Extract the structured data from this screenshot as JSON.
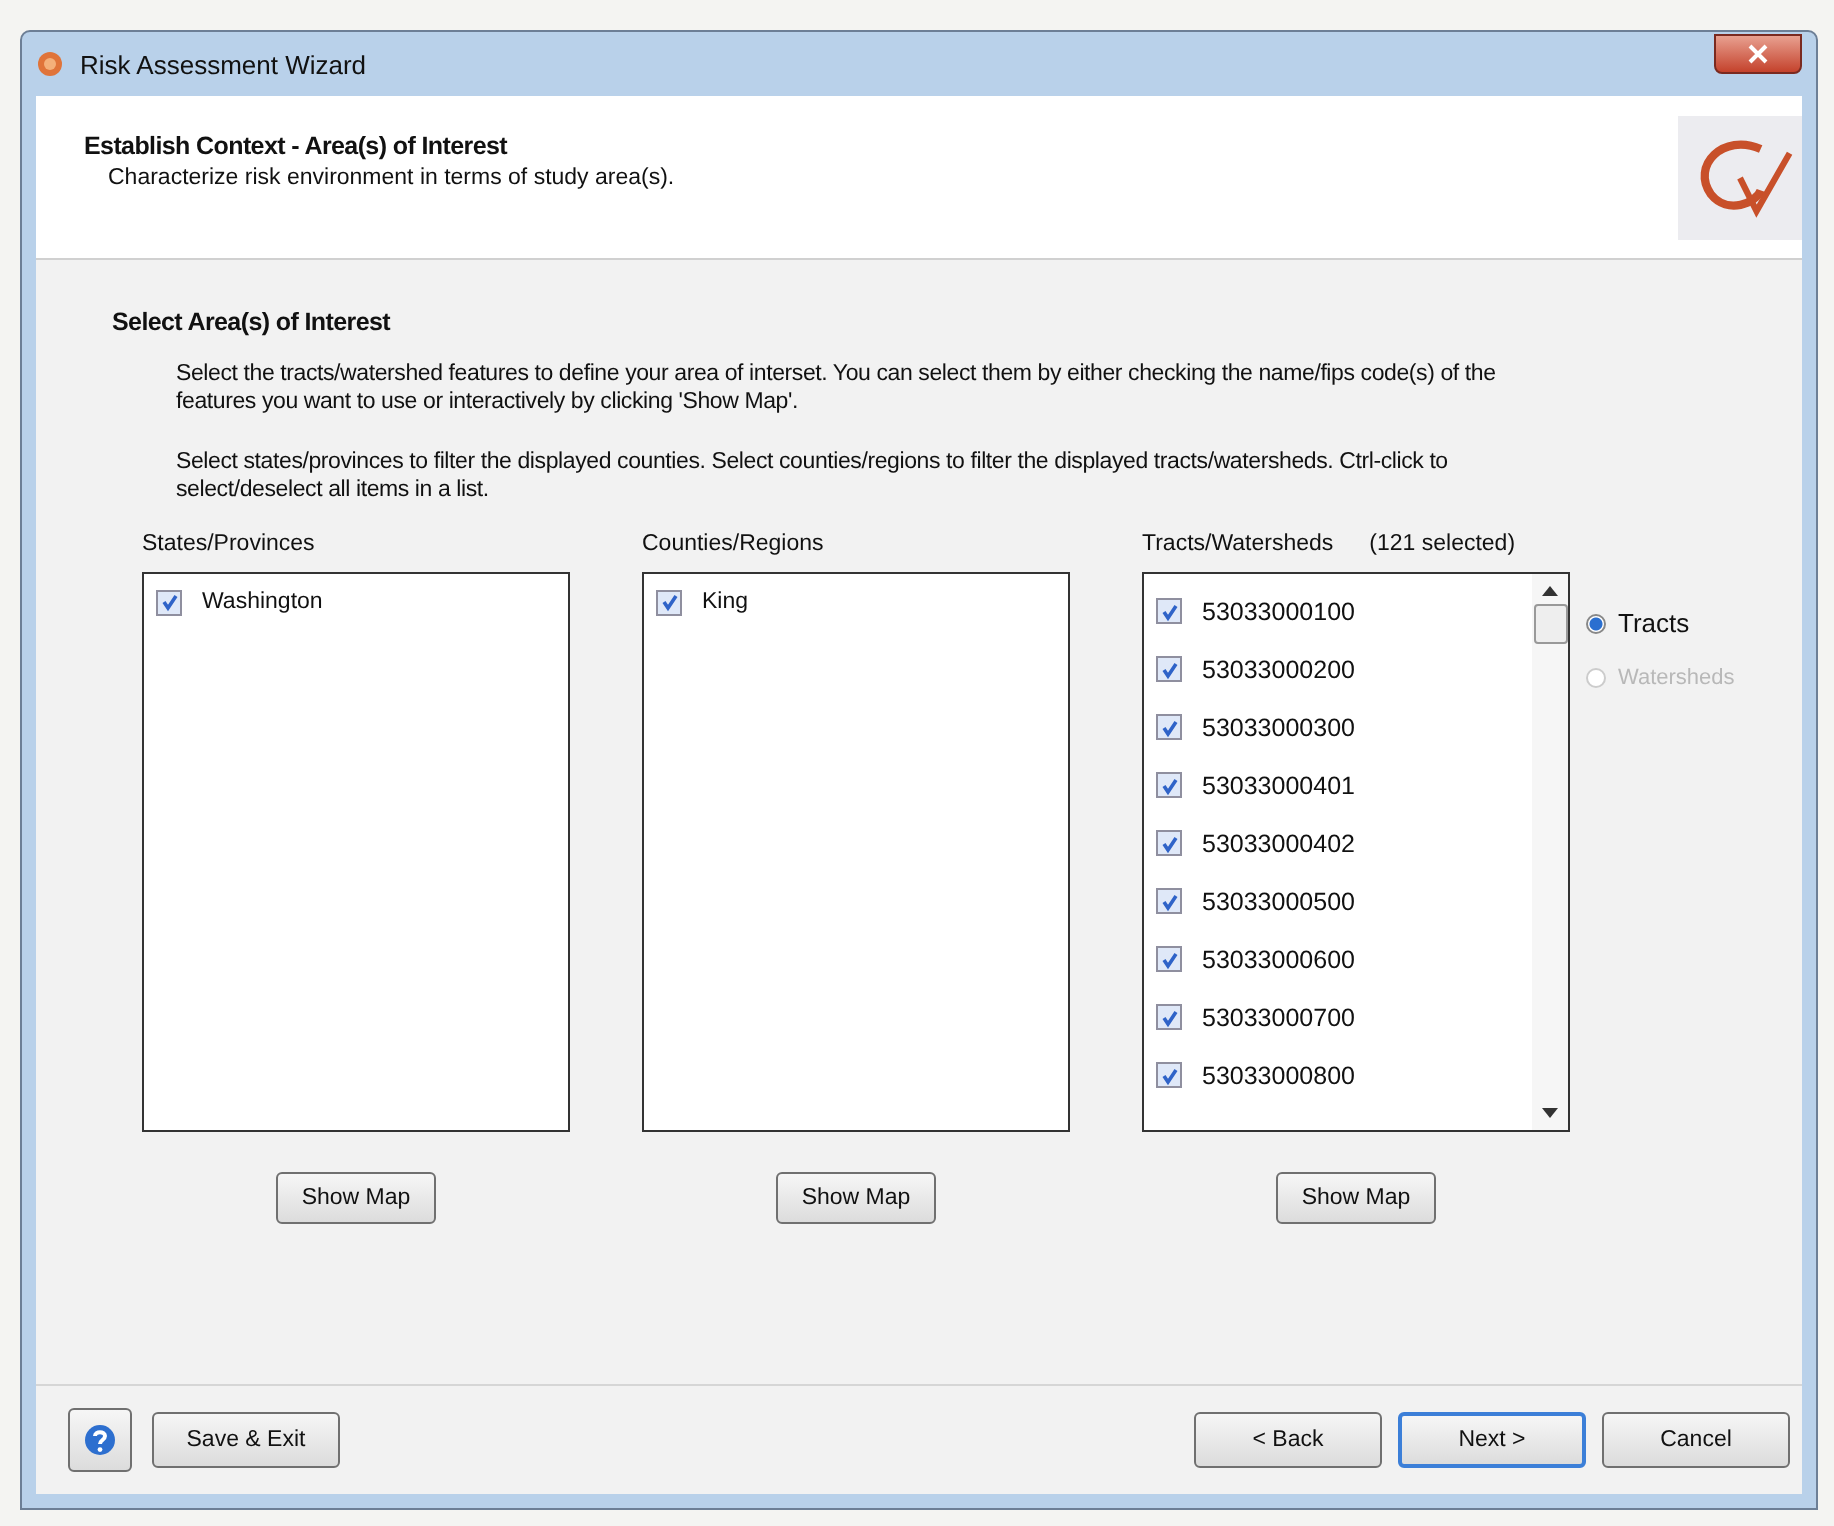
{
  "window": {
    "title": "Risk Assessment Wizard"
  },
  "header": {
    "title": "Establish Context - Area(s) of Interest",
    "subtitle": "Characterize risk environment in terms of study area(s)."
  },
  "section": {
    "title": "Select Area(s) of Interest",
    "paragraphs": [
      "Select the tracts/watershed features to define your area of interset.  You can select them by either checking the name/fips code(s) of the features you want to use or interactively by clicking 'Show Map'.",
      "Select states/provinces to filter the displayed counties.  Select counties/regions to filter the displayed tracts/watersheds.  Ctrl-click to select/deselect all items in a list."
    ]
  },
  "lists": [
    {
      "label": "States/Provinces",
      "items": [
        {
          "label": "Washington",
          "checked": true
        }
      ],
      "button": "Show Map"
    },
    {
      "label": "Counties/Regions",
      "items": [
        {
          "label": "King",
          "checked": true
        }
      ],
      "button": "Show Map"
    },
    {
      "label": "Tracts/Watersheds",
      "count": "(121 selected)",
      "scrollable": true,
      "items": [
        {
          "label": "53033000100",
          "checked": true
        },
        {
          "label": "53033000200",
          "checked": true
        },
        {
          "label": "53033000300",
          "checked": true
        },
        {
          "label": "53033000401",
          "checked": true
        },
        {
          "label": "53033000402",
          "checked": true
        },
        {
          "label": "53033000500",
          "checked": true
        },
        {
          "label": "53033000600",
          "checked": true
        },
        {
          "label": "53033000700",
          "checked": true
        },
        {
          "label": "53033000800",
          "checked": true
        }
      ],
      "button": "Show Map"
    }
  ],
  "view_options": [
    {
      "label": "Tracts",
      "selected": true,
      "disabled": false
    },
    {
      "label": "Watersheds",
      "selected": false,
      "disabled": true
    }
  ],
  "footer": {
    "left": [
      "Save & Exit"
    ],
    "right": [
      {
        "label": "< Back",
        "default": false
      },
      {
        "label": "Next >",
        "default": true
      },
      {
        "label": "Cancel",
        "default": false
      }
    ]
  }
}
